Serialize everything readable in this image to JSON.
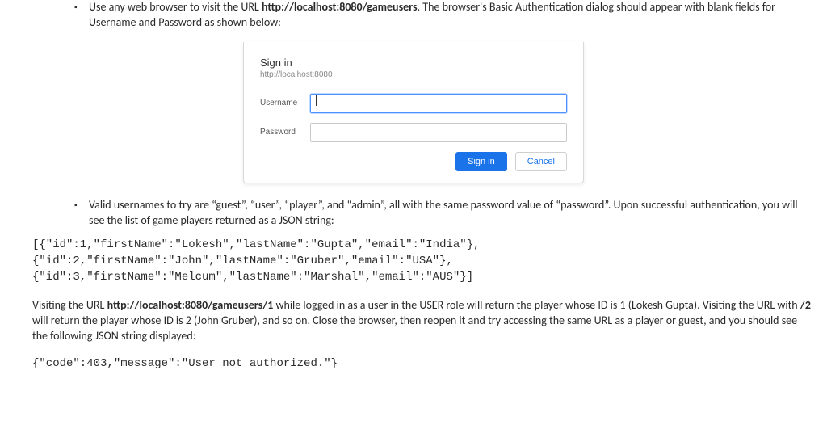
{
  "bullets": {
    "b1_pre": "Use any web browser to visit the URL ",
    "b1_url": "http://localhost:8080/gameusers",
    "b1_post": ". The browser's Basic Authentication dialog should appear with blank fields for Username and Password as shown below:",
    "b2": "Valid usernames to try are “guest”, “user”, “player”, and “admin”, all with the same password value of “password”. Upon successful authentication, you will see the list of game players returned as a JSON string:"
  },
  "dialog": {
    "title": "Sign in",
    "origin": "http://localhost:8080",
    "username_label": "Username",
    "password_label": "Password",
    "signin_btn": "Sign in",
    "cancel_btn": "Cancel"
  },
  "json_block": "[{\"id\":1,\"firstName\":\"Lokesh\",\"lastName\":\"Gupta\",\"email\":\"India\"},\n{\"id\":2,\"firstName\":\"John\",\"lastName\":\"Gruber\",\"email\":\"USA\"},\n{\"id\":3,\"firstName\":\"Melcum\",\"lastName\":\"Marshal\",\"email\":\"AUS\"}]",
  "para": {
    "p1_a": "Visiting the URL ",
    "p1_url": "http://localhost:8080/gameusers/1",
    "p1_b": " while logged in as a user in the USER role will return the player whose ID is 1 (Lokesh Gupta). Visiting the URL with ",
    "p1_slash2": "/2",
    "p1_c": " will return the player whose ID is 2 (John Gruber), and so on. Close the browser, then reopen it and try accessing the same URL as a player or guest, and you should see the following JSON string displayed:"
  },
  "error_block": "{\"code\":403,\"message\":\"User not authorized.\"}"
}
